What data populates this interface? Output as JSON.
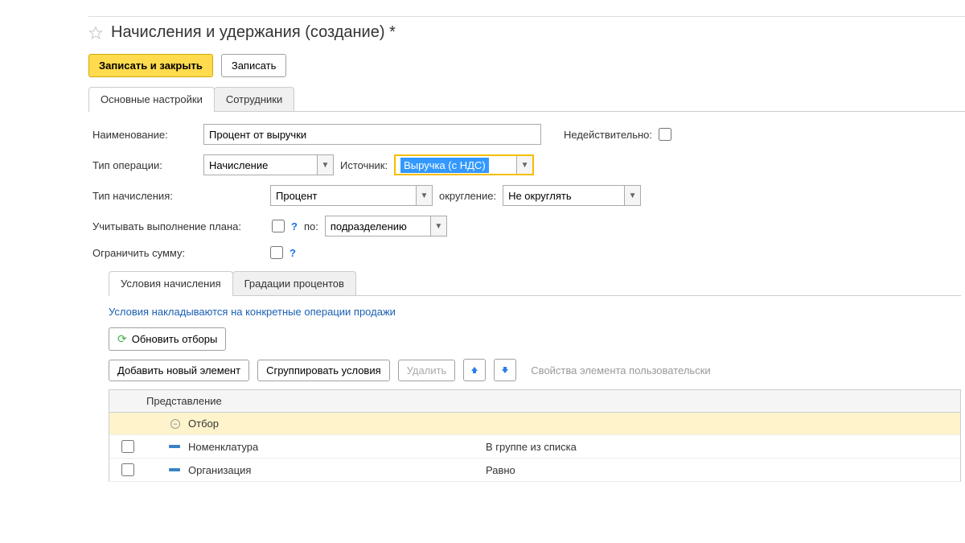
{
  "title": "Начисления и удержания (создание) *",
  "toolbar": {
    "save_close": "Записать и закрыть",
    "save": "Записать"
  },
  "tabs": {
    "main": "Основные настройки",
    "employees": "Сотрудники"
  },
  "form": {
    "name_label": "Наименование:",
    "name_value": "Процент от выручки",
    "inactive_label": "Недействительно:",
    "op_type_label": "Тип операции:",
    "op_type_value": "Начисление",
    "source_label": "Источник:",
    "source_value": "Выручка (с НДС)",
    "accrual_type_label": "Тип начисления:",
    "accrual_type_value": "Процент",
    "rounding_label": "округление:",
    "rounding_value": "Не округлять",
    "plan_label": "Учитывать выполнение плана:",
    "by_label": "по:",
    "by_value": "подразделению",
    "limit_label": "Ограничить сумму:"
  },
  "subtabs": {
    "conditions": "Условия начисления",
    "gradations": "Градации процентов"
  },
  "desc_link": "Условия накладываются на конкретные операции продажи",
  "toolbar2": {
    "refresh": "Обновить отборы",
    "add": "Добавить новый элемент",
    "group": "Сгруппировать условия",
    "delete": "Удалить",
    "props": "Свойства элемента пользовательски"
  },
  "table": {
    "header": "Представление",
    "rows": [
      {
        "type": "group",
        "name": "Отбор",
        "cond": ""
      },
      {
        "type": "item",
        "name": "Номенклатура",
        "cond": "В группе из списка"
      },
      {
        "type": "item",
        "name": "Организация",
        "cond": "Равно"
      }
    ]
  }
}
